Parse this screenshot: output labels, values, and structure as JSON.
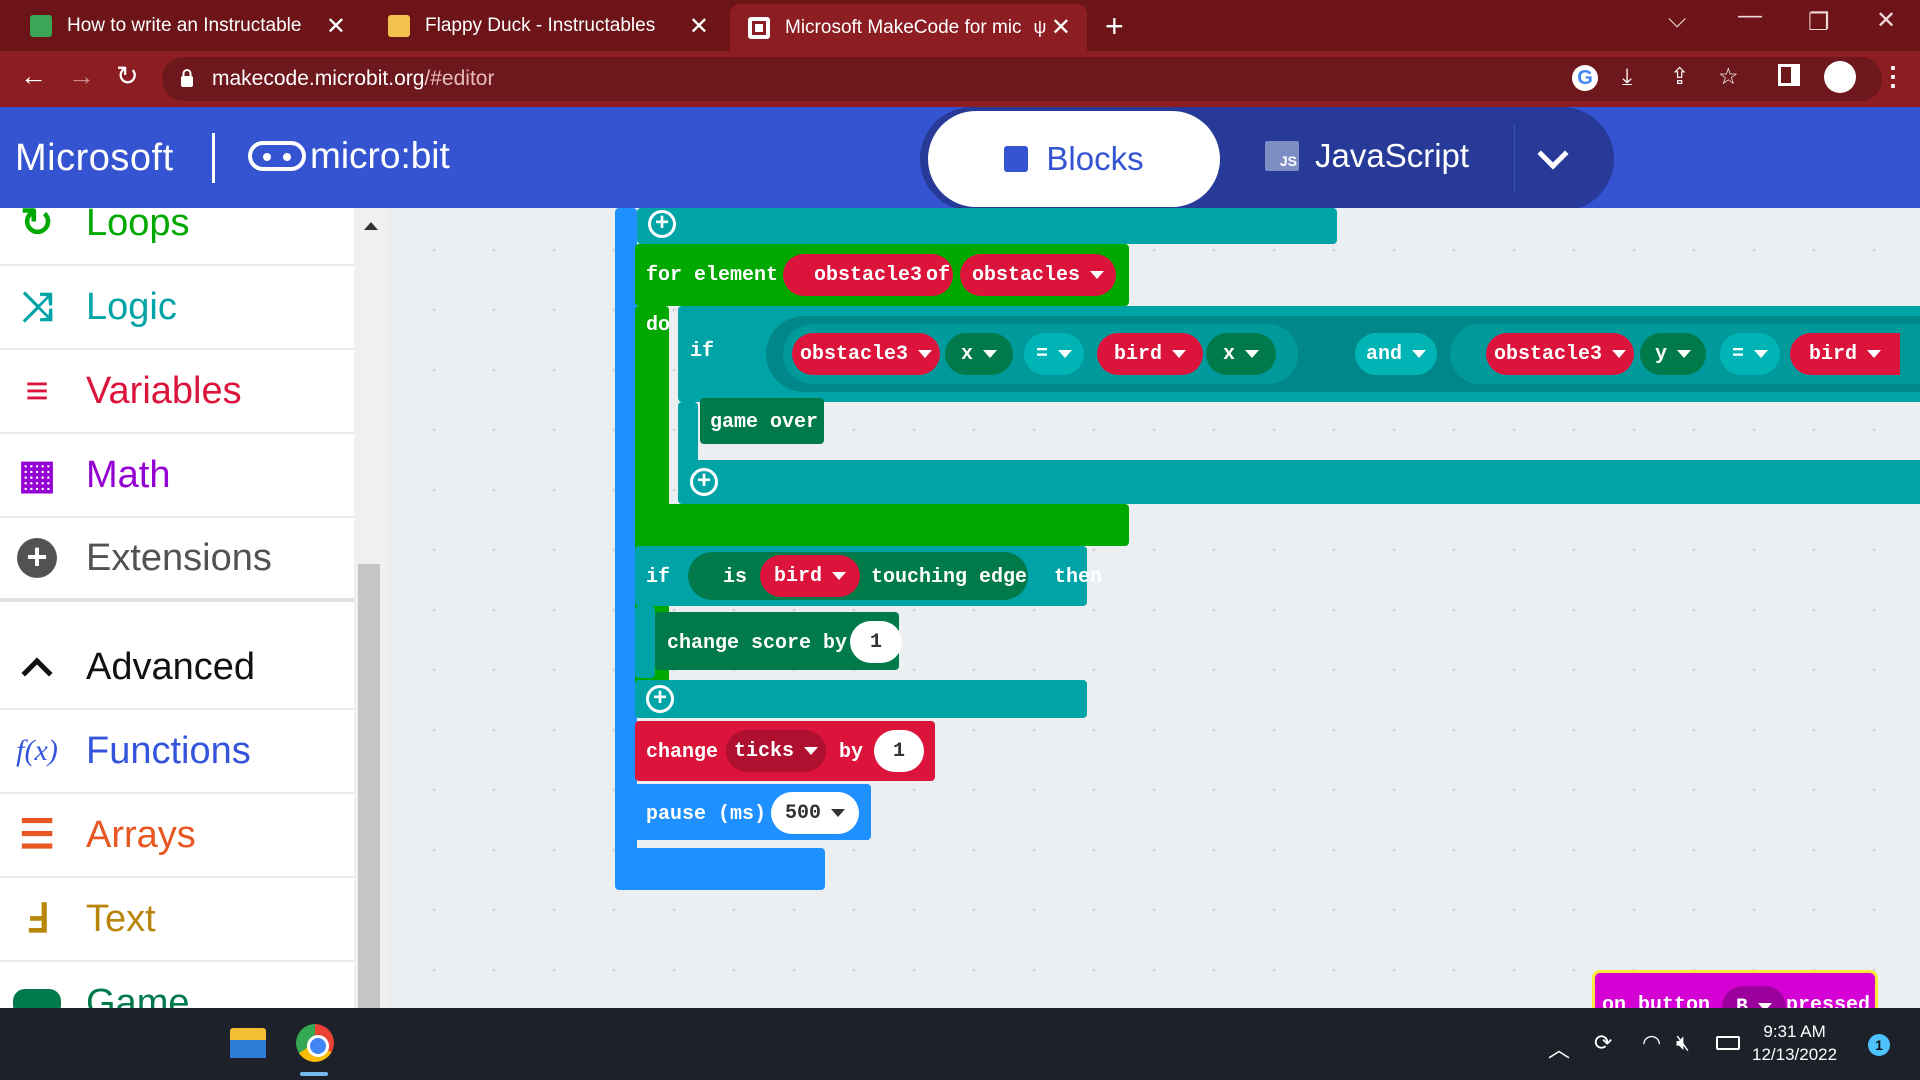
{
  "browser": {
    "tabs": [
      {
        "title": "How to write an Instructable",
        "favicon": "instructables-favicon"
      },
      {
        "title": "Flappy Duck - Instructables",
        "favicon": "duck-favicon"
      },
      {
        "title": "Microsoft MakeCode for mic",
        "favicon": "microbit-favicon",
        "active": true
      }
    ],
    "url_host": "makecode.microbit.org",
    "url_path": "/#editor"
  },
  "header": {
    "microsoft": "Microsoft",
    "microbit": "micro:bit",
    "blocks_label": "Blocks",
    "javascript_label": "JavaScript",
    "js_badge": "JS"
  },
  "toolbox": {
    "items": [
      {
        "label": "Loops",
        "color": "#00a800",
        "icon": "loops-icon"
      },
      {
        "label": "Logic",
        "color": "#00a4a6",
        "icon": "logic-icon"
      },
      {
        "label": "Variables",
        "color": "#dc143c",
        "icon": "variables-icon"
      },
      {
        "label": "Math",
        "color": "#9400d3",
        "icon": "math-icon"
      },
      {
        "label": "Extensions",
        "color": "#525252",
        "icon": "extensions-icon"
      },
      {
        "label": "Advanced",
        "color": "#000000",
        "icon": "advanced-icon"
      },
      {
        "label": "Functions",
        "color": "#3455db",
        "icon": "functions-icon"
      },
      {
        "label": "Arrays",
        "color": "#e65722",
        "icon": "arrays-icon"
      },
      {
        "label": "Text",
        "color": "#b8860b",
        "icon": "text-icon"
      },
      {
        "label": "Game",
        "color": "#007a4b",
        "icon": "game-icon"
      }
    ]
  },
  "blocks": {
    "for_element": "for element",
    "for_var": "obstacle3",
    "for_of": "of",
    "for_list": "obstacles",
    "do": "do",
    "if": "if",
    "cmp1_a": "obstacle3",
    "cmp1_a_prop": "x",
    "cmp1_op": "=",
    "cmp1_b": "bird",
    "cmp1_b_prop": "x",
    "and": "and",
    "cmp2_a": "obstacle3",
    "cmp2_a_prop": "y",
    "cmp2_op": "=",
    "cmp2_b": "bird",
    "game_over": "game over",
    "if2": "if",
    "is": "is",
    "sprite": "bird",
    "touching_edge": "touching edge",
    "then": "then",
    "change_score": "change score by",
    "score_val": "1",
    "change": "change",
    "ticks": "ticks",
    "by": "by",
    "ticks_val": "1",
    "pause": "pause (ms)",
    "pause_val": "500",
    "on_button": "on button",
    "button": "B",
    "pressed": "pressed"
  },
  "colors": {
    "loops": "#00a800",
    "logic": "#00a4a6",
    "variables": "#dc143c",
    "game": "#007a4b",
    "basic": "#1e90ff",
    "input": "#d400d4"
  },
  "taskbar": {
    "time": "9:31 AM",
    "date": "12/13/2022",
    "notifications": "1"
  }
}
